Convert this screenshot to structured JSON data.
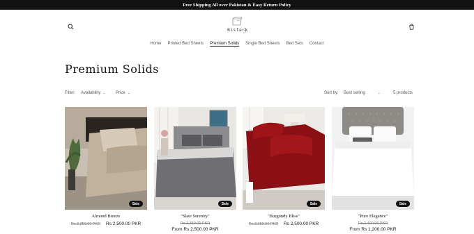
{
  "announcement": "Free Shipping All over Pakistan & Easy Return Policy",
  "header": {
    "logo_text": "Bistark"
  },
  "nav": [
    {
      "label": "Home",
      "active": false
    },
    {
      "label": "Printed Bed Sheets",
      "active": false
    },
    {
      "label": "Premium Solids",
      "active": true
    },
    {
      "label": "Single Bed Sheets",
      "active": false
    },
    {
      "label": "Bed Sets",
      "active": false
    },
    {
      "label": "Contact",
      "active": false
    }
  ],
  "page_title": "Premium Solids",
  "filters": {
    "filter_label": "Filter:",
    "availability": "Availability",
    "price": "Price",
    "sort_label": "Sort by:",
    "sort_value": "Best selling",
    "count": "5 products"
  },
  "products": [
    {
      "name": "Almond Breeze",
      "compare_price": "Rs.3,350.00 PKR",
      "price": "Rs 2,500.00 PKR",
      "badge": "Sale",
      "prefix": ""
    },
    {
      "name": "\"Slate Serenity\"",
      "compare_price": "Rs.3,350.00 PKR",
      "price": "Rs 2,500.00 PKR",
      "badge": "Sale",
      "prefix": "From "
    },
    {
      "name": "\"Burgundy Bliss\"",
      "compare_price": "Rs.3,350.00 PKR",
      "price": "Rs 2,500.00 PKR",
      "badge": "Sale",
      "prefix": ""
    },
    {
      "name": "\"Pure Elegance\"",
      "compare_price": "Rs.2,400.00 PKR",
      "price": "Rs 1,200.00 PKR",
      "badge": "Sale",
      "prefix": "From "
    }
  ],
  "colors": {
    "announcement_bg": "#121212",
    "text": "#121212",
    "muted": "#555555"
  }
}
